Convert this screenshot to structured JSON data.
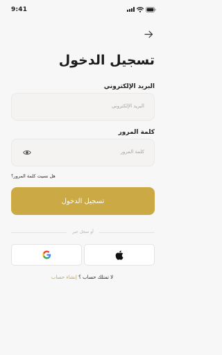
{
  "status": {
    "time": "9:41"
  },
  "header": {
    "back_icon": "arrow-right-icon"
  },
  "title": "تسجيل الدخول",
  "email": {
    "label": "البريد الإلكتروني",
    "placeholder": "البريد الإلكتروني"
  },
  "password": {
    "label": "كلمة المرور",
    "placeholder": "كلمة المرور",
    "toggle_icon": "eye-icon"
  },
  "forgot_password": "هل نسيت كلمة المرور؟",
  "login_button": "تسجيل الدخول",
  "divider_text": "أو سجل عبر",
  "social": {
    "apple_icon": "apple-icon",
    "google_icon": "google-icon"
  },
  "signup": {
    "prompt": "لا تمتلك حساب ؟",
    "link": "إنشاء حساب"
  },
  "colors": {
    "accent": "#cba944",
    "link": "#c9a23f",
    "background": "#f7f7f7"
  }
}
